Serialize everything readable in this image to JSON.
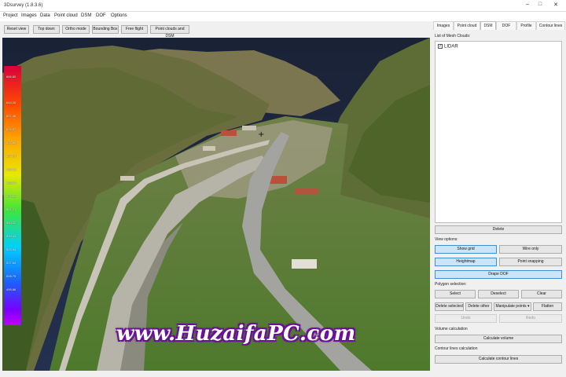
{
  "window": {
    "title": "3Dsurvey (1.8.3.6)",
    "controls": [
      "–",
      "□",
      "✕"
    ]
  },
  "menu": [
    "Project",
    "Images",
    "Data",
    "Point cloud",
    "DSM",
    "DOF",
    "Options"
  ],
  "toolbar": [
    "Reset view",
    "Top down",
    "Ortho mode",
    "Bounding Box",
    "Free flight",
    "Point clouds and DSM"
  ],
  "colorbar": {
    "labels": [
      "666.80",
      "648.26",
      "637.46",
      "626.57",
      "615.68",
      "604.79",
      "593.89",
      "583.00",
      "572.11",
      "561.21",
      "550.32",
      "539.43",
      "528.54",
      "517.64",
      "506.75",
      "495.86"
    ]
  },
  "viewport": {
    "watermark": "www.HuzaifaPC.com",
    "cursor_glyph": "+"
  },
  "panel": {
    "tabs": [
      "Images",
      "Point cloud",
      "DSM",
      "DOF",
      "Profile",
      "Contour lines"
    ],
    "active_tab": "DSM",
    "list_title": "List of Mesh Clouds:",
    "list_item": "LIDAR",
    "list_item_checked": true,
    "delete": "Delete",
    "view_options": "View options:",
    "show_grid": "Show grid",
    "wire_only": "Wire only",
    "heightmap": "Heightmap",
    "point_snapping": "Point snapping",
    "drape_dof": "Drape DOF",
    "polygon_selection": "Polygon selection:",
    "select": "Select",
    "deselect": "Deselect",
    "clear": "Clear",
    "delete_selected": "Delete selected",
    "delete_other": "Delete other",
    "manipulate_points": "Manipulate points ▾",
    "flatten": "Flatten",
    "undo": "Undo",
    "redo": "Redo",
    "volume_calc": "Volume calculation",
    "calculate_volume": "Calculate volume",
    "contour_calc": "Contour lines calculation",
    "calculate_contour": "Calculate contour lines"
  },
  "colors": {
    "accent": "#3c8fd6",
    "toggle_on": "#cce4f7",
    "sky": "#1b2540",
    "grass": "#4f7a2e",
    "road": "#9a9a9a"
  }
}
